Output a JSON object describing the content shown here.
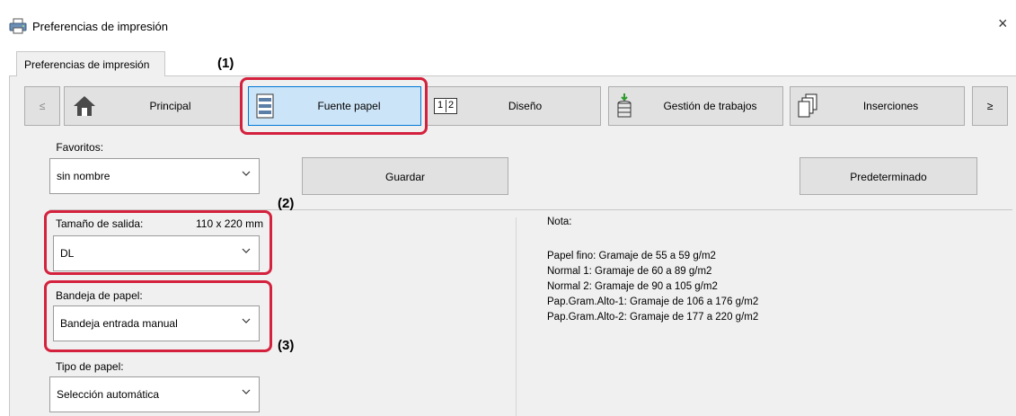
{
  "window": {
    "title": "Preferencias de impresión",
    "close_glyph": "×"
  },
  "tab": {
    "label": "Preferencias de impresión"
  },
  "nav": {
    "prev": "≤",
    "next": "≥",
    "items": [
      {
        "label": "Principal",
        "icon": "home-icon"
      },
      {
        "label": "Fuente papel",
        "icon": "paper-tray-icon",
        "selected": true
      },
      {
        "label": "Diseño",
        "icon": "layout-icon",
        "icon_text_1": "1",
        "icon_text_2": "2"
      },
      {
        "label": "Gestión de trabajos",
        "icon": "job-stack-icon"
      },
      {
        "label": "Inserciones",
        "icon": "insert-pages-icon"
      }
    ]
  },
  "favorites": {
    "label": "Favoritos:",
    "value": "sin nombre",
    "save_button": "Guardar",
    "default_button": "Predeterminado"
  },
  "output_size": {
    "label": "Tamaño de salida:",
    "dimensions": "110 x 220 mm",
    "value": "DL"
  },
  "paper_tray": {
    "label": "Bandeja de papel:",
    "value": "Bandeja entrada manual"
  },
  "paper_type": {
    "label": "Tipo de papel:",
    "value": "Selección automática"
  },
  "note": {
    "heading": "Nota:",
    "lines": [
      "Papel fino: Gramaje de 55 a 59 g/m2",
      "Normal 1: Gramaje de 60 a 89 g/m2",
      "Normal 2: Gramaje de 90 a 105 g/m2",
      "Pap.Gram.Alto-1: Gramaje de 106 a 176 g/m2",
      "Pap.Gram.Alto-2: Gramaje de 177 a 220 g/m2"
    ]
  },
  "callouts": {
    "c1": "(1)",
    "c2": "(2)",
    "c3": "(3)"
  },
  "colors": {
    "highlight_frame": "#d4213d",
    "selected_button": "#cce4f7",
    "selected_border": "#0078d7"
  }
}
